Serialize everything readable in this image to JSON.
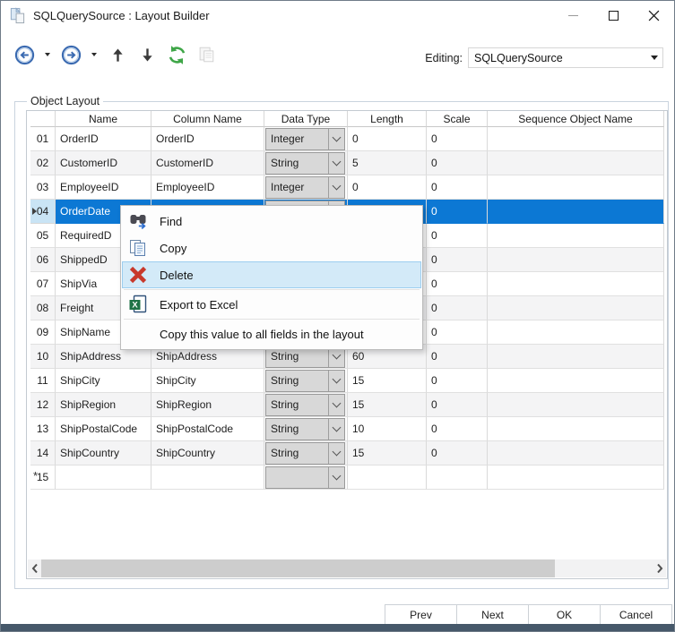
{
  "window": {
    "title": "SQLQuerySource : Layout Builder",
    "controls": [
      "minimize-icon",
      "maximize-icon",
      "close-icon"
    ]
  },
  "toolbar": {
    "icons": [
      {
        "name": "back-icon"
      },
      {
        "name": "back-dropdown-icon",
        "dropdown": true
      },
      {
        "name": "forward-icon"
      },
      {
        "name": "forward-dropdown-icon",
        "dropdown": true
      },
      {
        "name": "move-up-icon"
      },
      {
        "name": "move-down-icon"
      },
      {
        "name": "refresh-icon"
      },
      {
        "name": "paste-layout-icon",
        "disabled": true
      }
    ],
    "editing_label": "Editing:",
    "editing_value": "SQLQuerySource"
  },
  "groupbox": {
    "label": "Object Layout"
  },
  "grid": {
    "columns": [
      "",
      "Name",
      "Column Name",
      "Data Type",
      "Length",
      "Scale",
      "Sequence Object Name"
    ],
    "rows": [
      {
        "num": "01",
        "name": "OrderID",
        "column_name": "OrderID",
        "data_type": "Integer",
        "length": "0",
        "scale": "0",
        "sequence": ""
      },
      {
        "num": "02",
        "name": "CustomerID",
        "column_name": "CustomerID",
        "data_type": "String",
        "length": "5",
        "scale": "0",
        "sequence": ""
      },
      {
        "num": "03",
        "name": "EmployeeID",
        "column_name": "EmployeeID",
        "data_type": "Integer",
        "length": "0",
        "scale": "0",
        "sequence": ""
      },
      {
        "num": "04",
        "name": "OrderDate",
        "column_name": "",
        "data_type": "",
        "length": "",
        "scale": "0",
        "sequence": "",
        "selected": true
      },
      {
        "num": "05",
        "name": "RequiredD",
        "column_name": "",
        "data_type": "",
        "length": "",
        "scale": "0",
        "sequence": ""
      },
      {
        "num": "06",
        "name": "ShippedD",
        "column_name": "",
        "data_type": "",
        "length": "",
        "scale": "0",
        "sequence": ""
      },
      {
        "num": "07",
        "name": "ShipVia",
        "column_name": "",
        "data_type": "",
        "length": "",
        "scale": "0",
        "sequence": ""
      },
      {
        "num": "08",
        "name": "Freight",
        "column_name": "",
        "data_type": "",
        "length": "",
        "scale": "0",
        "sequence": ""
      },
      {
        "num": "09",
        "name": "ShipName",
        "column_name": "",
        "data_type": "",
        "length": "",
        "scale": "0",
        "sequence": ""
      },
      {
        "num": "10",
        "name": "ShipAddress",
        "column_name": "ShipAddress",
        "data_type": "String",
        "length": "60",
        "scale": "0",
        "sequence": ""
      },
      {
        "num": "11",
        "name": "ShipCity",
        "column_name": "ShipCity",
        "data_type": "String",
        "length": "15",
        "scale": "0",
        "sequence": ""
      },
      {
        "num": "12",
        "name": "ShipRegion",
        "column_name": "ShipRegion",
        "data_type": "String",
        "length": "15",
        "scale": "0",
        "sequence": ""
      },
      {
        "num": "13",
        "name": "ShipPostalCode",
        "column_name": "ShipPostalCode",
        "data_type": "String",
        "length": "10",
        "scale": "0",
        "sequence": ""
      },
      {
        "num": "14",
        "name": "ShipCountry",
        "column_name": "ShipCountry",
        "data_type": "String",
        "length": "15",
        "scale": "0",
        "sequence": ""
      },
      {
        "num": "15",
        "name": "",
        "column_name": "",
        "data_type": "",
        "length": "",
        "scale": "",
        "sequence": "",
        "new_row": true,
        "marker": "*"
      }
    ]
  },
  "context_menu": {
    "items": [
      {
        "label": "Find",
        "icon": "find-icon"
      },
      {
        "label": "Copy",
        "icon": "copy-icon"
      },
      {
        "label": "Delete",
        "icon": "delete-icon",
        "highlighted": true
      },
      {
        "label": "Export to Excel",
        "icon": "excel-icon",
        "separator_above": true
      },
      {
        "label": "Copy this value to all fields in the layout",
        "icon": null,
        "separator_above": true
      }
    ]
  },
  "scrollbar": {
    "left_arrow": "chevron-left-icon",
    "right_arrow": "chevron-right-icon"
  },
  "footer": {
    "buttons": [
      {
        "label": "Prev",
        "name": "prev-button"
      },
      {
        "label": "Next",
        "name": "next-button"
      },
      {
        "label": "OK",
        "name": "ok-button"
      },
      {
        "label": "Cancel",
        "name": "cancel-button"
      }
    ]
  },
  "colors": {
    "selection": "#0c78d4",
    "selection_row_header": "#c9e4f5",
    "menu_highlight": "#d3eaf8",
    "menu_highlight_border": "#9ccef0",
    "bottom_bar": "#46586a",
    "refresh_green": "#3fa648",
    "delete_red": "#c8392b",
    "nav_blue": "#3a6ab1"
  }
}
